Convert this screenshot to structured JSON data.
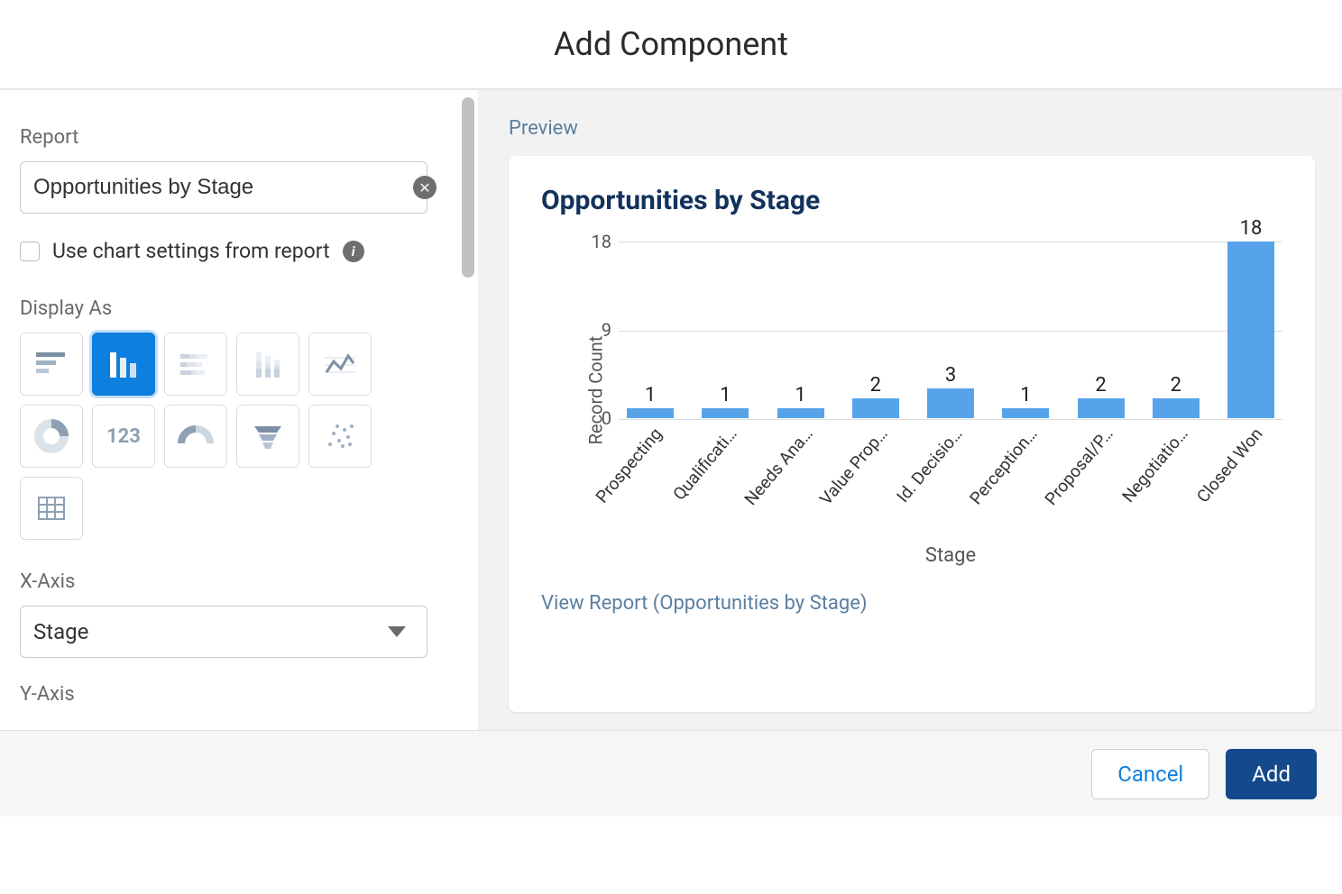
{
  "header": {
    "title": "Add Component"
  },
  "left": {
    "report_label": "Report",
    "report_value": "Opportunities by Stage",
    "use_chart_settings_label": "Use chart settings from report",
    "display_as_label": "Display As",
    "chart_types": [
      "horizontal-bar",
      "vertical-bar",
      "stacked-bar-h",
      "stacked-bar-v",
      "line",
      "donut",
      "metric",
      "gauge",
      "funnel",
      "scatter",
      "table"
    ],
    "selected_chart_type_index": 1,
    "xaxis_label": "X-Axis",
    "xaxis_value": "Stage",
    "yaxis_label": "Y-Axis"
  },
  "preview": {
    "label": "Preview",
    "title": "Opportunities by Stage",
    "view_report_label": "View Report (Opportunities by Stage)"
  },
  "chart_data": {
    "type": "bar",
    "title": "Opportunities by Stage",
    "xlabel": "Stage",
    "ylabel": "Record Count",
    "ylim": [
      0,
      18
    ],
    "yticks": [
      0,
      9,
      18
    ],
    "categories": [
      "Prospecting",
      "Qualificati…",
      "Needs Ana…",
      "Value Prop…",
      "Id. Decisio…",
      "Perception…",
      "Proposal/P…",
      "Negotiatio…",
      "Closed Won"
    ],
    "values": [
      1,
      1,
      1,
      2,
      3,
      1,
      2,
      2,
      18
    ]
  },
  "footer": {
    "cancel": "Cancel",
    "add": "Add"
  }
}
